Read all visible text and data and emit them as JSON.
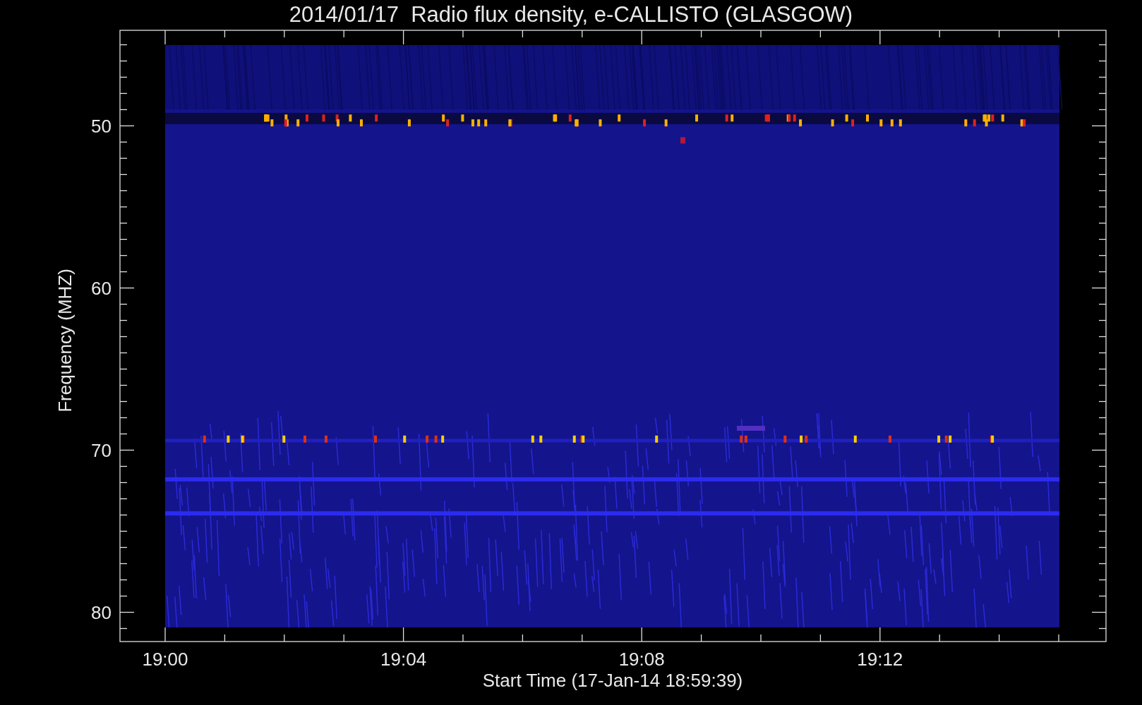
{
  "title": "2014/01/17  Radio flux density, e-CALLISTO (GLASGOW)",
  "y_axis": {
    "label": "Frequency (MHZ)",
    "ticks": [
      "50",
      "60",
      "70",
      "80"
    ]
  },
  "x_axis": {
    "label": "Start Time (17-Jan-14 18:59:39)",
    "ticks": [
      "19:00",
      "19:04",
      "19:08",
      "19:12"
    ]
  }
}
